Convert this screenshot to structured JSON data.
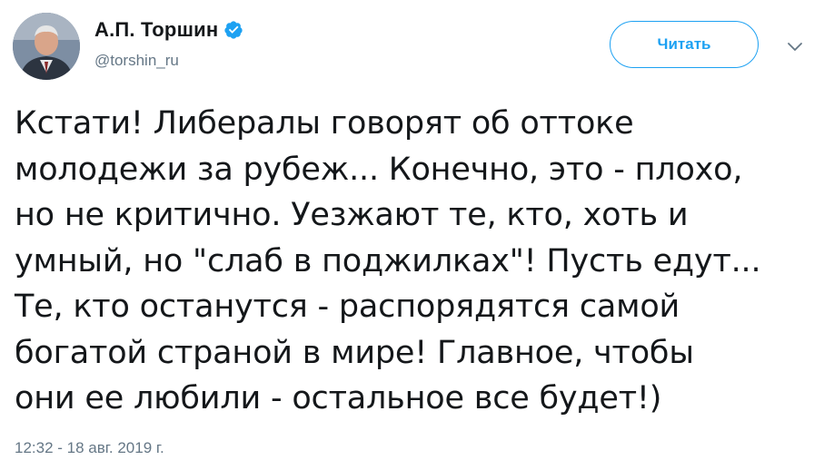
{
  "author": {
    "display_name": "А.П. Торшин",
    "handle": "@torshin_ru",
    "verified": true
  },
  "follow_button": {
    "label": "Читать"
  },
  "tweet": {
    "text": "Кстати! Либералы говорят об оттоке\nмолодежи за рубеж... Конечно, это - плохо,\nно не критично. Уезжают те, кто, хоть и\nумный, но \"слаб в поджилках\"! Пусть едут...\nТе, кто останутся - распорядятся самой\nбогатой страной в мире! Главное, чтобы\nони ее любили - остальное все будет!)",
    "timestamp": "12:32 - 18 авг. 2019 г."
  },
  "icons": {
    "verified": "verified-badge-icon",
    "menu": "chevron-down-icon"
  },
  "colors": {
    "accent": "#1da1f2",
    "text": "#14171a",
    "secondary": "#657786"
  }
}
